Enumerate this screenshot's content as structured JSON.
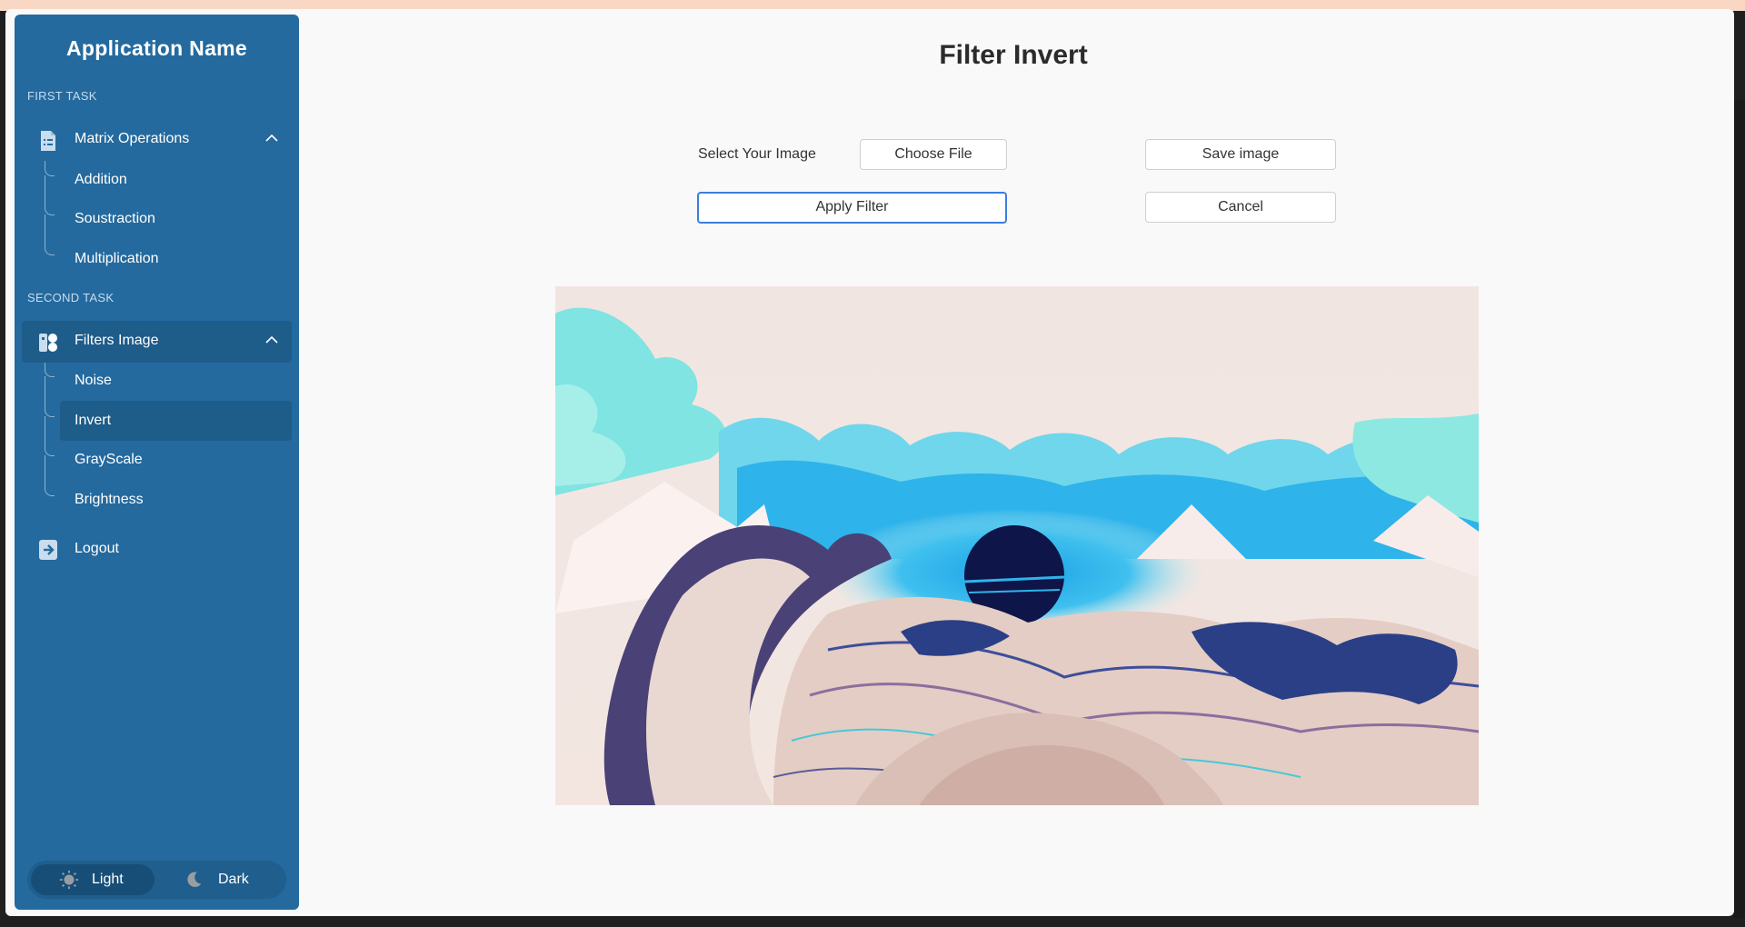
{
  "app": {
    "name": "Application Name"
  },
  "sidebar": {
    "sections": [
      {
        "label": "FIRST TASK",
        "group": {
          "label": "Matrix Operations",
          "icon": "document-list-icon",
          "items": [
            "Addition",
            "Soustraction",
            "Multiplication"
          ]
        }
      },
      {
        "label": "SECOND TASK",
        "group": {
          "label": "Filters Image",
          "icon": "filter-toggle-icon",
          "items": [
            "Noise",
            "Invert",
            "GrayScale",
            "Brightness"
          ]
        }
      }
    ],
    "active_item": "Invert",
    "logout_label": "Logout",
    "theme": {
      "light_label": "Light",
      "dark_label": "Dark",
      "selected": "Light"
    }
  },
  "main": {
    "title": "Filter Invert",
    "select_label": "Select Your Image",
    "choose_file_label": "Choose File",
    "save_label": "Save image",
    "apply_label": "Apply Filter",
    "cancel_label": "Cancel"
  },
  "colors": {
    "sidebar_bg": "#246a9e",
    "sidebar_active": "#1e5c8a",
    "focus_border": "#3d7ce0",
    "page_bg": "#f9f9f9"
  }
}
